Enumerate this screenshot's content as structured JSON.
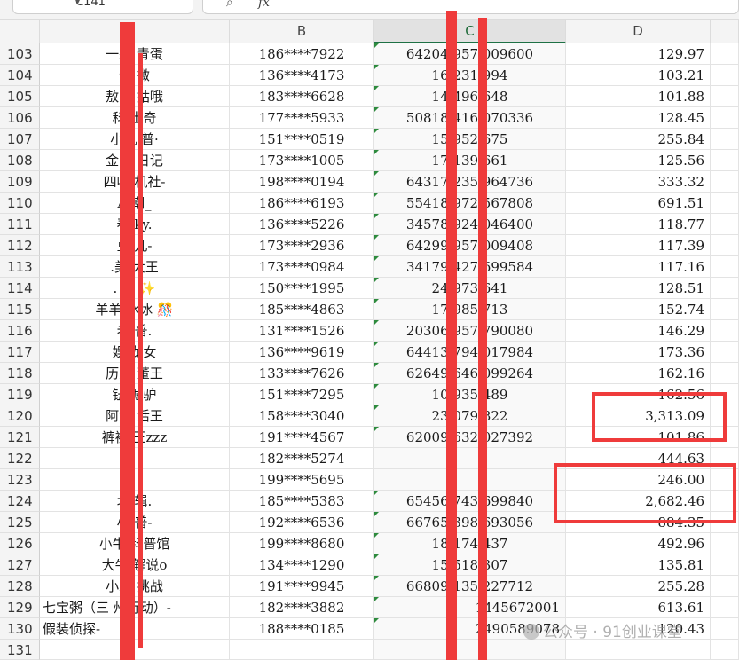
{
  "name_box": {
    "value": "C141"
  },
  "formula_bar": {
    "value": ""
  },
  "columns": [
    "B",
    "C",
    "D"
  ],
  "rows": [
    {
      "n": "103",
      "a": "一颗 青蛋",
      "b": "186****7922",
      "c": "64204 957 009600",
      "d": "129.97"
    },
    {
      "n": "104",
      "a": "馆 微",
      "b": "136****4173",
      "c": "16 231 994",
      "d": "103.21"
    },
    {
      "n": "105",
      "a": "敖闰 姑哦",
      "b": "183****6628",
      "c": "14 496 648",
      "d": "101.88"
    },
    {
      "n": "106",
      "a": "科 士奇",
      "b": "177****5933",
      "c": "50818 416 070336",
      "d": "128.45"
    },
    {
      "n": "107",
      "a": "小机 普·",
      "b": "151****0519",
      "c": "15 952 675",
      "d": "255.84"
    },
    {
      "n": "108",
      "a": "金毛 日记",
      "b": "173****1005",
      "c": "17 139 661",
      "d": "125.56"
    },
    {
      "n": "109",
      "a": "四叶 机社-",
      "b": "198****0194",
      "c": "64317 235 964736",
      "d": "333.32"
    },
    {
      "n": "110",
      "a": "A 潮_",
      "b": "186****6193",
      "c": "55418 972 567808",
      "d": "691.51"
    },
    {
      "n": "111",
      "a": "春 ky.",
      "b": "136****5226",
      "c": "34578 924 046400",
      "d": "118.77"
    },
    {
      "n": "112",
      "a": "豆 儿-",
      "b": "173****2936",
      "c": "64299 957 009408",
      "d": "117.39"
    },
    {
      "n": "113",
      "a": ".美 大王",
      "b": "173****0984",
      "c": "34179 427 699584",
      "d": "117.16"
    },
    {
      "n": "114",
      "a": ". 西 ✨",
      "b": "150****1995",
      "c": "24 973 641",
      "d": "128.51"
    },
    {
      "n": "115",
      "a": "羊羊 冰冰 🎊",
      "b": "185****4863",
      "c": "17 985 713",
      "d": "152.74"
    },
    {
      "n": "116",
      "a": "老 普.",
      "b": "131****1526",
      "c": "20306 957 790080",
      "d": "146.29"
    },
    {
      "n": "117",
      "a": "娱 龙女",
      "b": "136****9619",
      "c": "64413 794 017984",
      "d": "173.36"
    },
    {
      "n": "118",
      "a": "历史 董王",
      "b": "133****7626",
      "c": "62649 646 099264",
      "d": "162.16"
    },
    {
      "n": "119",
      "a": "钮 倔驴",
      "b": "151****7295",
      "c": "10 935 489",
      "d": "162.56"
    },
    {
      "n": "120",
      "a": "阿浪 活王",
      "b": "158****3040",
      "c": "23 079 822",
      "d": "3,313.09"
    },
    {
      "n": "121",
      "a": "裤裤 王zzz",
      "b": "191****4567",
      "c": "62009 632 027392",
      "d": "101.86"
    },
    {
      "n": "122",
      "a": "",
      "b": "182****5274",
      "c": "",
      "d": "444.63"
    },
    {
      "n": "123",
      "a": "",
      "b": "199****5695",
      "c": "",
      "d": "246.00"
    },
    {
      "n": "124",
      "a": "北 辑.",
      "b": "185****5383",
      "c": "65456 743 699840",
      "d": "2,682.46"
    },
    {
      "n": "125",
      "a": "小 普-",
      "b": "192****6536",
      "c": "66765 398 693056",
      "d": "884.35"
    },
    {
      "n": "126",
      "a": "小牛 科普馆",
      "b": "199****8680",
      "c": "18 174 437",
      "d": "492.96"
    },
    {
      "n": "127",
      "a": "大牛 解说o",
      "b": "134****1290",
      "c": "15 518 307",
      "d": "135.81"
    },
    {
      "n": "128",
      "a": "小芯 挑战",
      "b": "191****9945",
      "c": "66809 135 227712",
      "d": "255.28"
    },
    {
      "n": "129",
      "a": "七宝粥（三 州行动）-",
      "b": "182****3882",
      "c": "1445672001",
      "d": "613.61"
    },
    {
      "n": "130",
      "a": "假装侦探-",
      "b": "188****0185",
      "c": "2490589078",
      "d": "120.43"
    },
    {
      "n": "131",
      "a": "",
      "b": "",
      "c": "",
      "d": ""
    }
  ],
  "watermark": {
    "text": "公众号 · 91创业课堂"
  },
  "colors": {
    "annotation_red": "#ef3b3b",
    "selected_header_green": "#1e7145"
  }
}
